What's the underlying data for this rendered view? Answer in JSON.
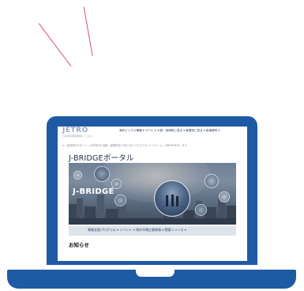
{
  "illustration": {
    "laptop_color": "#1f5aa5",
    "accent_line_color": "#d94f6a"
  },
  "site": {
    "logo_text": "JETRO",
    "logo_subtext": "日本貿易振興機構(ジェトロ)",
    "top_nav": "海外ビジネス情報 ▾   サービス ▾   国・地域別に見る ▾   産業別に見る ▾   各事務所 ▾",
    "breadcrumb": "⌂ › 会員向けサポート › J-BRIDGE 高度・起業的な人材とのビジネスプラットフォーム › J-BRIDGEポータル",
    "page_title": "J-BRIDGEポータル",
    "hero_logo": "J-BRIDGE",
    "sub_nav": "事業支援プログラム ▾   イベント ▾   海外市場企業情報 ▾   関連ニュース ▾",
    "section_title": "お知らせ"
  }
}
